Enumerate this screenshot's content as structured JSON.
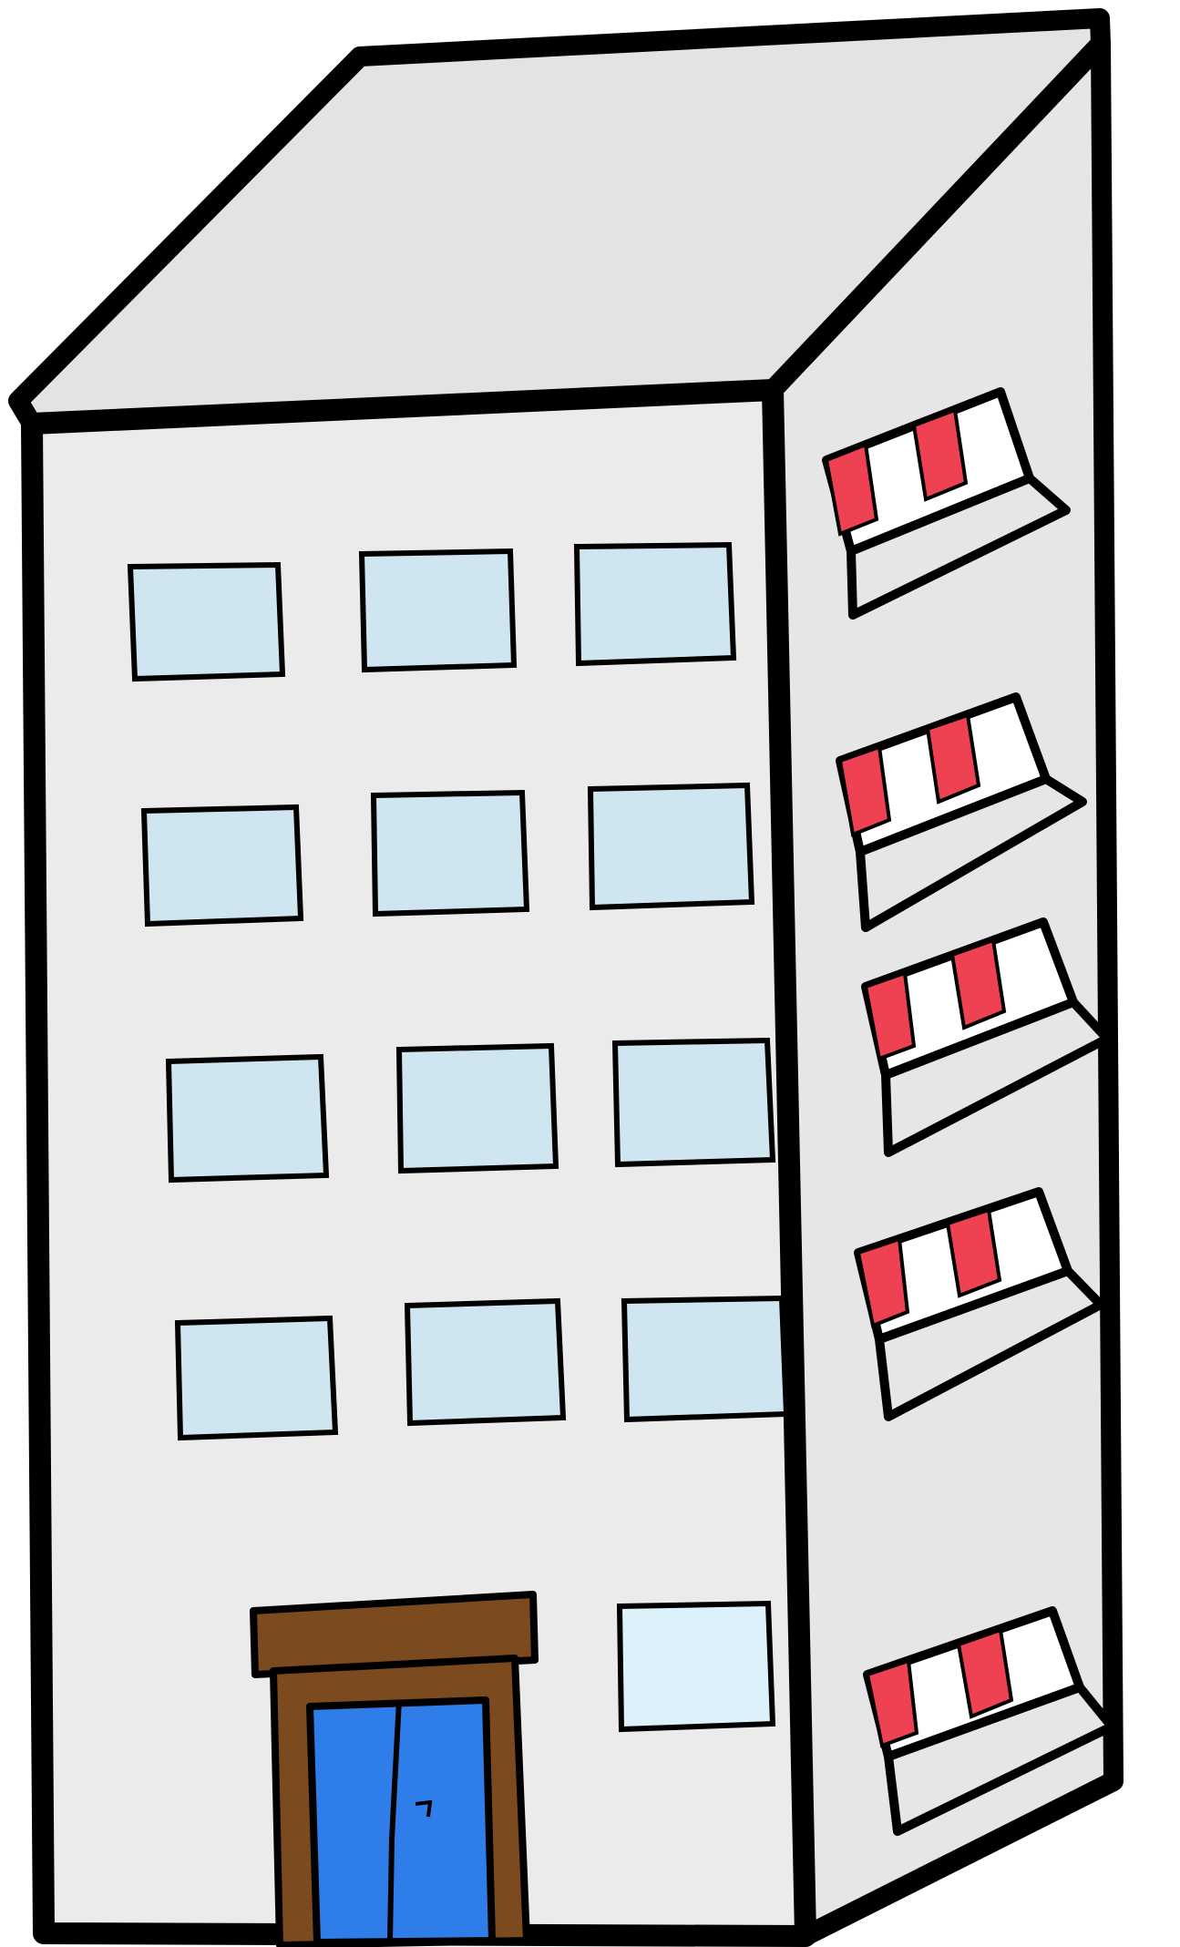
{
  "illustration": {
    "subject": "apartment-building",
    "front_window_rows": 4,
    "front_window_columns": 3,
    "ground_floor_windows": 1,
    "side_balconies": 5
  },
  "colors": {
    "background": "#ffffff",
    "outline": "#000000",
    "wall_front": "#ebebeb",
    "wall_side": "#e6e6e6",
    "roof": "#e3e3e3",
    "window_glass": "#cfe6f1",
    "window_glass_light": "#dcf1fa",
    "balcony_stripe_red": "#ee4252",
    "balcony_stripe_white": "#ffffff",
    "door_frame": "#7b4a1e",
    "door_glass": "#2f7de8"
  }
}
